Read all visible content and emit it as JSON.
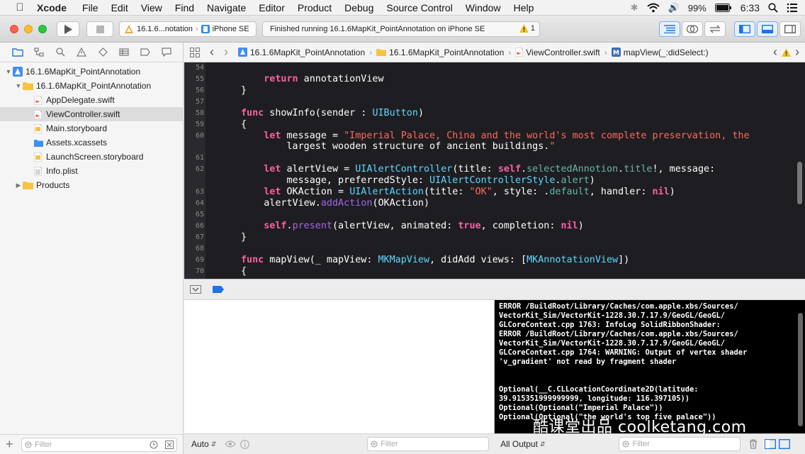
{
  "menubar": {
    "app_name": "Xcode",
    "items": [
      "File",
      "Edit",
      "View",
      "Find",
      "Navigate",
      "Editor",
      "Product",
      "Debug",
      "Source Control",
      "Window",
      "Help"
    ],
    "battery": "99%",
    "time": "6:33"
  },
  "toolbar": {
    "scheme_name": "16.1.6...notation",
    "device": "iPhone SE",
    "activity_text": "Finished running 16.1.6MapKit_PointAnnotation on iPhone SE",
    "warning_count": "1"
  },
  "navigator": {
    "items": [
      {
        "label": "16.1.6MapKit_PointAnnotation",
        "level": 0,
        "icon": "project-icon",
        "expanded": true
      },
      {
        "label": "16.1.6MapKit_PointAnnotation",
        "level": 1,
        "icon": "folder-icon",
        "expanded": true
      },
      {
        "label": "AppDelegate.swift",
        "level": 2,
        "icon": "swift-file-icon"
      },
      {
        "label": "ViewController.swift",
        "level": 2,
        "icon": "swift-file-icon",
        "selected": true
      },
      {
        "label": "Main.storyboard",
        "level": 2,
        "icon": "storyboard-icon"
      },
      {
        "label": "Assets.xcassets",
        "level": 2,
        "icon": "assets-folder-icon"
      },
      {
        "label": "LaunchScreen.storyboard",
        "level": 2,
        "icon": "storyboard-icon"
      },
      {
        "label": "Info.plist",
        "level": 2,
        "icon": "plist-icon"
      },
      {
        "label": "Products",
        "level": 1,
        "icon": "folder-icon",
        "expanded": false
      }
    ],
    "filter_placeholder": "Filter"
  },
  "jumpbar": {
    "crumbs": [
      "16.1.6MapKit_PointAnnotation",
      "16.1.6MapKit_PointAnnotation",
      "ViewController.swift",
      "mapView(_:didSelect:)"
    ]
  },
  "editor": {
    "line_numbers": [
      "54",
      "55",
      "56",
      "57",
      "58",
      "59",
      "60",
      "",
      "61",
      "62",
      "",
      "63",
      "64",
      "65",
      "66",
      "67",
      "68",
      "69",
      "70"
    ],
    "lines": [
      "",
      "        return annotationView",
      "    }",
      "",
      "    func showInfo(sender : UIButton)",
      "    {",
      "        let message = \"Imperial Palace, China and the world's most complete preservation, the",
      "            largest wooden structure of ancient buildings.\"",
      "",
      "        let alertView = UIAlertController(title: self.selectedAnnotion.title!, message:",
      "            message, preferredStyle: UIAlertControllerStyle.alert)",
      "        let OKAction = UIAlertAction(title: \"OK\", style: .default, handler: nil)",
      "        alertView.addAction(OKAction)",
      "",
      "        self.present(alertView, animated: true, completion: nil)",
      "    }",
      "",
      "    func mapView(_ mapView: MKMapView, didAdd views: [MKAnnotationView])",
      "    {"
    ]
  },
  "console": {
    "lines": [
      "ERROR /BuildRoot/Library/Caches/com.apple.xbs/Sources/",
      "VectorKit_Sim/VectorKit-1228.30.7.17.9/GeoGL/GeoGL/",
      "GLCoreContext.cpp 1763: InfoLog SolidRibbonShader:",
      "ERROR /BuildRoot/Library/Caches/com.apple.xbs/Sources/",
      "VectorKit_Sim/VectorKit-1228.30.7.17.9/GeoGL/GeoGL/",
      "GLCoreContext.cpp 1764: WARNING: Output of vertex shader",
      "'v_gradient' not read by fragment shader",
      "",
      "",
      "Optional(__C.CLLocationCoordinate2D(latitude:",
      "39.915351999999999, longitude: 116.397105))",
      "Optional(Optional(\"Imperial Palace\"))",
      "Optional(Optional(\"the world's top five palace\"))"
    ]
  },
  "bottombar": {
    "auto_label": "Auto",
    "filter_placeholder": "Filter",
    "output_label": "All Output",
    "console_filter_placeholder": "Filter"
  },
  "watermark": "酷课堂出品 coolketang.com",
  "colors": {
    "keyword": "#fc5fa3",
    "type": "#5dd8ff",
    "string": "#fc6a5d",
    "accent": "#1d74e7"
  }
}
